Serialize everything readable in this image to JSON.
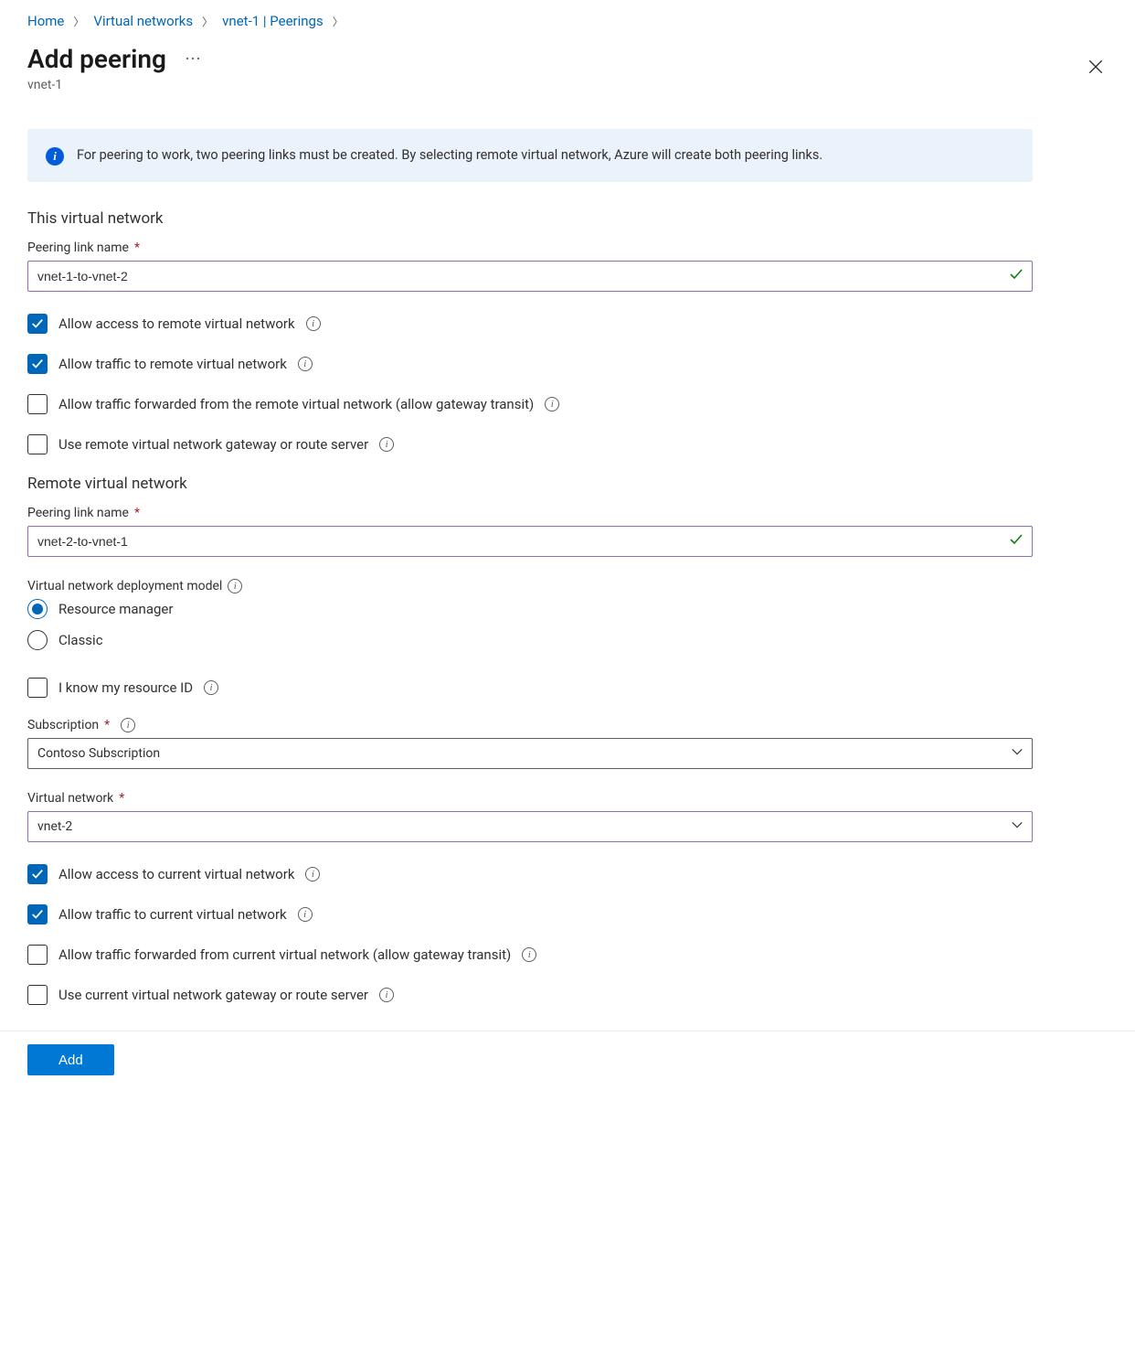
{
  "breadcrumb": {
    "home": "Home",
    "vnets": "Virtual networks",
    "peerings": "vnet-1 | Peerings"
  },
  "header": {
    "title": "Add peering",
    "subtitle": "vnet-1"
  },
  "info_banner": "For peering to work, two peering links must be created. By selecting remote virtual network, Azure will create both peering links.",
  "this_vnet": {
    "heading": "This virtual network",
    "link_name_label": "Peering link name",
    "link_name_value": "vnet-1-to-vnet-2",
    "cb_allow_access": "Allow access to remote virtual network",
    "cb_allow_traffic": "Allow traffic to remote virtual network",
    "cb_allow_forwarded": "Allow traffic forwarded from the remote virtual network (allow gateway transit)",
    "cb_use_gateway": "Use remote virtual network gateway or route server"
  },
  "remote_vnet": {
    "heading": "Remote virtual network",
    "link_name_label": "Peering link name",
    "link_name_value": "vnet-2-to-vnet-1",
    "deploy_model_label": "Virtual network deployment model",
    "radio_rm": "Resource manager",
    "radio_classic": "Classic",
    "cb_know_id": "I know my resource ID",
    "subscription_label": "Subscription",
    "subscription_value": "Contoso Subscription",
    "vnet_label": "Virtual network",
    "vnet_value": "vnet-2",
    "cb_allow_access": "Allow access to current virtual network",
    "cb_allow_traffic": "Allow traffic to current virtual network",
    "cb_allow_forwarded": "Allow traffic forwarded from current virtual network (allow gateway transit)",
    "cb_use_gateway": "Use current virtual network gateway or route server"
  },
  "footer": {
    "add": "Add"
  }
}
